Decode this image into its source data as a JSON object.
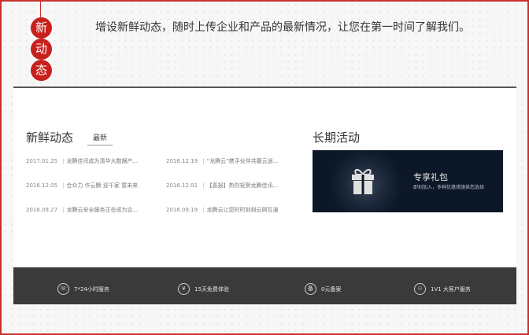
{
  "badge": [
    "新",
    "动",
    "态"
  ],
  "intro_text": "增设新鲜动态，随时上传企业和产品的最新情况，让您在第一时间了解我们。",
  "news": {
    "title": "新鲜动态",
    "tab": "最新",
    "left": [
      {
        "date": "2017.01.25",
        "text": "龙腾佳讯成为清华大数据产..."
      },
      {
        "date": "2016.12.05",
        "text": "合众力 作云腾 迎千家 誓未来"
      },
      {
        "date": "2016.09.27",
        "text": "龙腾云安全服务正在成为企..."
      }
    ],
    "right": [
      {
        "date": "2016.12.19",
        "text": "“龙腾云”携手伙伴共赢云途..."
      },
      {
        "date": "2016.12.01",
        "text": "【喜报】热烈祝贺龙腾佳讯..."
      },
      {
        "date": "2016.09.19",
        "text": "龙腾云让您时时刻刻云网互通"
      }
    ]
  },
  "activity": {
    "title": "长期活动",
    "promo_title": "专享礼包",
    "promo_sub": "即刻加入，多种优惠措施供您选择"
  },
  "footer": [
    {
      "icon": "phone-icon",
      "glyph": "☏",
      "label": "7*24小时服务"
    },
    {
      "icon": "yen-icon",
      "glyph": "¥",
      "label": "15天免费体验"
    },
    {
      "icon": "record-icon",
      "glyph": "备",
      "label": "0元备案"
    },
    {
      "icon": "vip-icon",
      "glyph": "⚇",
      "label": "1V1 大客户服务"
    }
  ],
  "colors": {
    "accent": "#c8201c",
    "footer_bg": "#3a3a3a",
    "promo_bg": "#0c1828"
  }
}
